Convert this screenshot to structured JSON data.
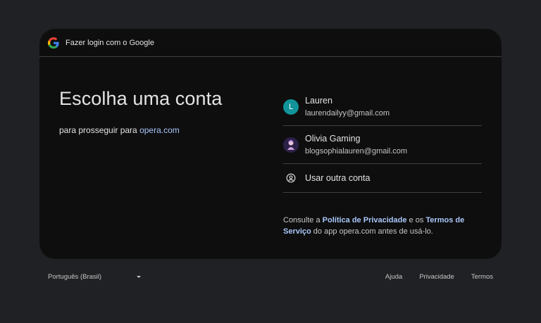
{
  "header": {
    "title": "Fazer login com o Google",
    "logo_icon": "google-g-icon"
  },
  "main": {
    "title": "Escolha uma conta",
    "subtitle_prefix": "para prosseguir para ",
    "subtitle_link": "opera.com"
  },
  "accounts": [
    {
      "name": "Lauren",
      "email": "laurendailyy@gmail.com",
      "avatar_letter": "L",
      "avatar_color": "#12939a"
    },
    {
      "name": "Olivia Gaming",
      "email": "blogsophialauren@gmail.com",
      "avatar_letter": "",
      "avatar_color": "#2b2046"
    }
  ],
  "other_account": {
    "label": "Usar outra conta",
    "icon": "account-circle-icon"
  },
  "terms": {
    "prefix": "Consulte a ",
    "privacy_link": "Política de Privacidade",
    "middle": " e os ",
    "terms_link": "Termos de Serviço",
    "suffix": " do app opera.com antes de usá-lo."
  },
  "footer": {
    "language": "Português (Brasil)",
    "links": [
      "Ajuda",
      "Privacidade",
      "Termos"
    ]
  },
  "colors": {
    "background": "#202124",
    "card": "#0e0e0e",
    "link": "#a8c7fa",
    "divider": "#3c4043"
  }
}
